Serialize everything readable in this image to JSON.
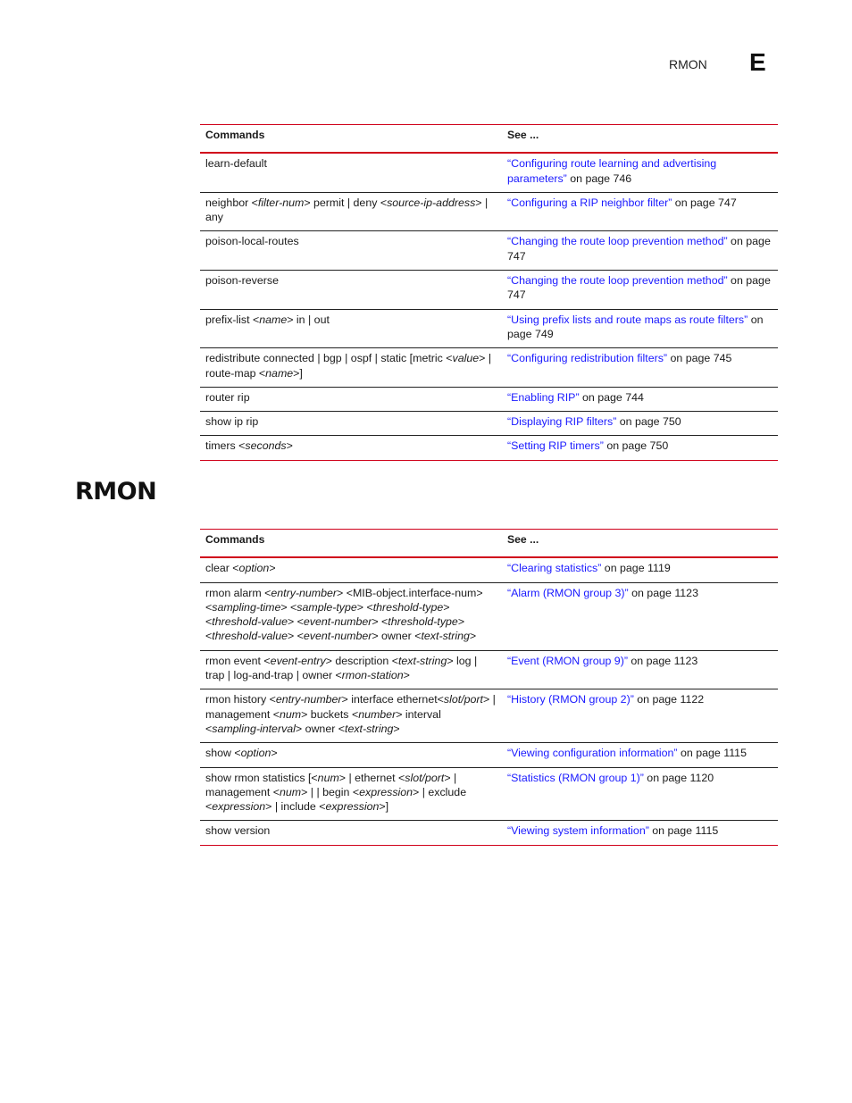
{
  "header": {
    "running_title": "RMON",
    "chapter_letter": "E"
  },
  "table1": {
    "headers": {
      "commands": "Commands",
      "see": "See ..."
    },
    "rows": [
      {
        "command": [
          [
            "t",
            "learn-default"
          ]
        ],
        "link": "“Configuring route learning and advertising parameters”",
        "page": " on page 746"
      },
      {
        "command": [
          [
            "t",
            "neighbor <"
          ],
          [
            "i",
            "filter-num"
          ],
          [
            "t",
            "> permit | deny <"
          ],
          [
            "i",
            "source-ip-address"
          ],
          [
            "t",
            "> | any"
          ]
        ],
        "link": "“Configuring a RIP neighbor filter”",
        "page": " on page 747"
      },
      {
        "command": [
          [
            "t",
            "poison-local-routes"
          ]
        ],
        "link": "“Changing the route loop prevention method”",
        "page": " on page 747"
      },
      {
        "command": [
          [
            "t",
            "poison-reverse"
          ]
        ],
        "link": "“Changing the route loop prevention method”",
        "page": " on page 747"
      },
      {
        "command": [
          [
            "t",
            "prefix-list <"
          ],
          [
            "i",
            "name"
          ],
          [
            "t",
            "> in | out"
          ]
        ],
        "link": "“Using prefix lists and route maps as route filters”",
        "page": " on page 749"
      },
      {
        "command": [
          [
            "t",
            "redistribute connected | bgp | ospf | static    [metric <"
          ],
          [
            "i",
            "value"
          ],
          [
            "t",
            "> | route-map <"
          ],
          [
            "i",
            "name"
          ],
          [
            "t",
            ">]"
          ]
        ],
        "link": "“Configuring redistribution filters”",
        "page": " on page 745"
      },
      {
        "command": [
          [
            "t",
            "router rip"
          ]
        ],
        "link": "“Enabling RIP”",
        "page": " on page 744"
      },
      {
        "command": [
          [
            "t",
            "show ip rip"
          ]
        ],
        "link": "“Displaying RIP filters”",
        "page": " on page 750"
      },
      {
        "command": [
          [
            "t",
            "timers <"
          ],
          [
            "i",
            "seconds"
          ],
          [
            "t",
            ">"
          ]
        ],
        "link": "“Setting RIP timers”",
        "page": " on page 750"
      }
    ]
  },
  "section": {
    "title": "RMON"
  },
  "table2": {
    "headers": {
      "commands": "Commands",
      "see": "See ..."
    },
    "rows": [
      {
        "command": [
          [
            "t",
            "clear <"
          ],
          [
            "i",
            "option"
          ],
          [
            "t",
            ">"
          ]
        ],
        "link": "“Clearing statistics”",
        "page": " on page 1119"
      },
      {
        "command": [
          [
            "t",
            "rmon alarm <"
          ],
          [
            "i",
            "entry-number"
          ],
          [
            "t",
            "> <MIB-object.interface-num> <"
          ],
          [
            "i",
            "sampling-time"
          ],
          [
            "t",
            "> <"
          ],
          [
            "i",
            "sample-type"
          ],
          [
            "t",
            "> <"
          ],
          [
            "i",
            "threshold-type"
          ],
          [
            "t",
            "> <"
          ],
          [
            "i",
            "threshold-value"
          ],
          [
            "t",
            "> <"
          ],
          [
            "i",
            "event-number"
          ],
          [
            "t",
            "> <"
          ],
          [
            "i",
            "threshold-type"
          ],
          [
            "t",
            "> <"
          ],
          [
            "i",
            "threshold-value"
          ],
          [
            "t",
            "> <"
          ],
          [
            "i",
            "event-number"
          ],
          [
            "t",
            "> owner <"
          ],
          [
            "i",
            "text-string"
          ],
          [
            "t",
            ">"
          ]
        ],
        "link": "“Alarm (RMON group 3)”",
        "page": " on page 1123"
      },
      {
        "command": [
          [
            "t",
            "rmon event <"
          ],
          [
            "i",
            "event-entry"
          ],
          [
            "t",
            "> description <"
          ],
          [
            "i",
            "text-string"
          ],
          [
            "t",
            "> log | trap | log-and-trap | owner <"
          ],
          [
            "i",
            "rmon-station"
          ],
          [
            "t",
            ">"
          ]
        ],
        "link": "“Event (RMON group 9)”",
        "page": " on page 1123"
      },
      {
        "command": [
          [
            "t",
            "rmon history <"
          ],
          [
            "i",
            "entry-number"
          ],
          [
            "t",
            "> interface ethernet<"
          ],
          [
            "i",
            "slot/port"
          ],
          [
            "t",
            "> | management <"
          ],
          [
            "i",
            "num"
          ],
          [
            "t",
            "> buckets <"
          ],
          [
            "i",
            "number"
          ],
          [
            "t",
            "> interval <"
          ],
          [
            "i",
            "sampling-interval"
          ],
          [
            "t",
            "> owner <"
          ],
          [
            "i",
            "text-string"
          ],
          [
            "t",
            ">"
          ]
        ],
        "link": "“History (RMON group 2)”",
        "page": " on page 1122"
      },
      {
        "command": [
          [
            "t",
            "show <"
          ],
          [
            "i",
            "option"
          ],
          [
            "t",
            ">"
          ]
        ],
        "link": "“Viewing configuration information”",
        "page": " on page 1115"
      },
      {
        "command": [
          [
            "t",
            "show rmon statistics [<"
          ],
          [
            "i",
            "num"
          ],
          [
            "t",
            "> | ethernet <"
          ],
          [
            "i",
            "slot/port"
          ],
          [
            "t",
            "> | management <"
          ],
          [
            "i",
            "num"
          ],
          [
            "t",
            "> | | begin <"
          ],
          [
            "i",
            "expression"
          ],
          [
            "t",
            "> | exclude <"
          ],
          [
            "i",
            "expression"
          ],
          [
            "t",
            "> | include <"
          ],
          [
            "i",
            "expression"
          ],
          [
            "t",
            ">]"
          ]
        ],
        "link": "“Statistics (RMON group 1)”",
        "page": " on page 1120"
      },
      {
        "command": [
          [
            "t",
            "show version"
          ]
        ],
        "link": "“Viewing system information”",
        "page": " on page 1115"
      }
    ]
  }
}
